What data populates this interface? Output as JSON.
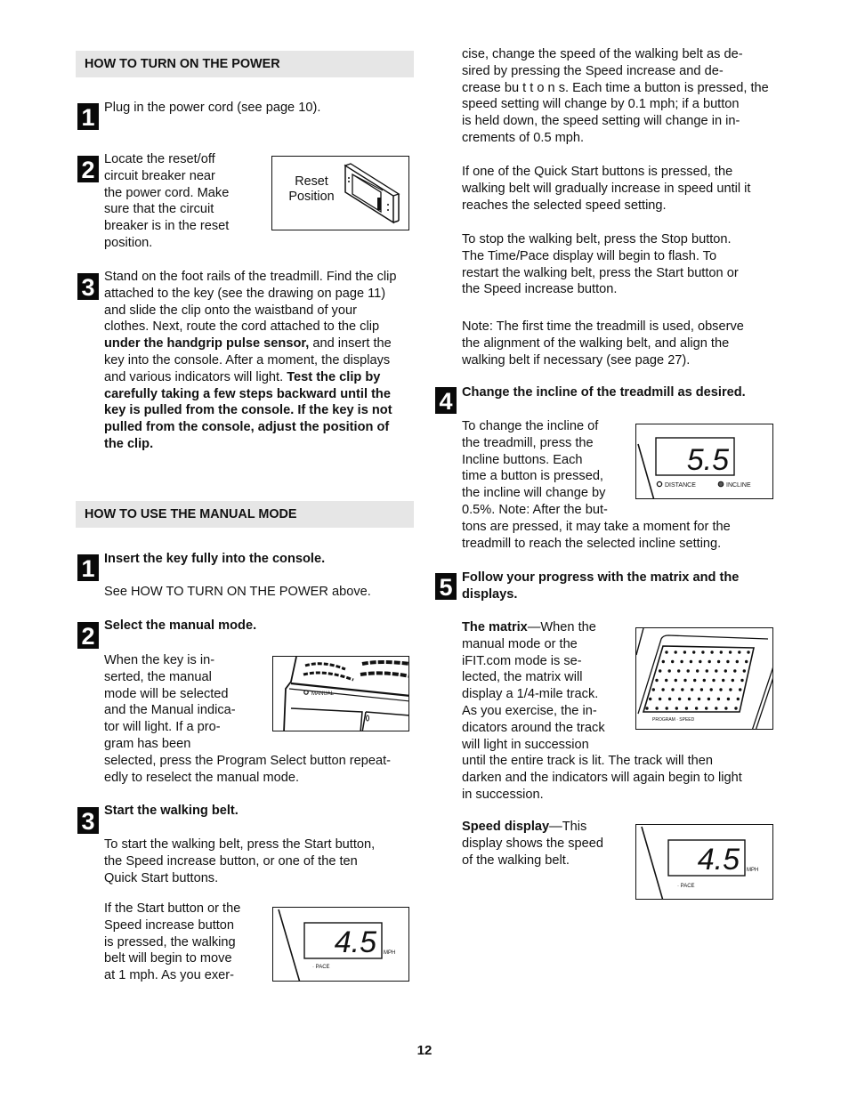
{
  "left_column": {
    "power_section": {
      "heading": "HOW TO TURN ON THE POWER",
      "steps": [
        {
          "number": "1",
          "text": "Plug in the power cord (see page 10)."
        },
        {
          "number": "2",
          "lines": [
            "Locate the reset/off",
            "circuit breaker near",
            "the power cord. Make",
            "sure that the circuit",
            "breaker is in the reset",
            "position."
          ],
          "figure": {
            "label_line1": "Reset",
            "label_line2": "Position",
            "icon": "circuit-breaker-illustration"
          }
        },
        {
          "number": "3",
          "lines": [
            {
              "normal": "Stand on the foot rails of the treadmill. Find the clip"
            },
            {
              "normal": "attached to the key (see the drawing on page 11)"
            },
            {
              "normal": "and slide the clip onto the waistband of your"
            },
            {
              "normal": "clothes. Next, route the cord attached to the clip"
            },
            {
              "bold": "under the handgrip pulse sensor,",
              "normal": " and insert the"
            },
            {
              "normal": "key into the console. After a moment, the displays"
            },
            {
              "normal": "and various indicators will light. ",
              "bold": "Test the clip by"
            },
            {
              "bold": "carefully taking a few steps backward until the"
            },
            {
              "bold": "key is pulled from the console. If the key is not"
            },
            {
              "bold": "pulled from the console, adjust the position of"
            },
            {
              "bold": "the clip."
            }
          ]
        }
      ]
    },
    "manual_section": {
      "heading": "HOW TO USE THE MANUAL MODE",
      "steps": [
        {
          "number": "1",
          "title": "Insert the key fully into the console.",
          "body": "See HOW TO TURN ON THE POWER above."
        },
        {
          "number": "2",
          "title": "Select the manual mode.",
          "lines": [
            "When the key is in-",
            "serted, the manual",
            "mode will be selected",
            "and the Manual indica-",
            "tor will light. If a pro-",
            "gram has been"
          ],
          "lines_full": [
            "selected, press the Program Select button repeat-",
            "edly to reselect the manual mode."
          ],
          "figure": {
            "icon": "console-manual-indicator-illustration"
          }
        },
        {
          "number": "3",
          "title": "Start the walking belt.",
          "body_lines": [
            "To start the walking belt, press the Start button,",
            "the Speed increase button, or one of the ten",
            "Quick Start buttons."
          ],
          "lines": [
            "If the Start button or the",
            "Speed increase button",
            "is pressed, the walking",
            "belt will begin to move",
            "at 1 mph. As you exer-"
          ],
          "figure": {
            "display_value": "4.5",
            "icon": "speed-display-illustration"
          }
        }
      ]
    }
  },
  "right_column": {
    "continued_lines": [
      "cise, change the speed of the walking belt as de-",
      "sired by pressing the Speed increase and de-",
      "crease bu t t o n s. Each time a button is pressed, the",
      "speed setting will change by 0.1 mph; if a button",
      "is held down, the speed setting will change in in-",
      "crements of 0.5 mph."
    ],
    "quick_start_lines": [
      "If one of the Quick Start buttons is pressed, the",
      "walking belt will gradually increase in speed until it",
      "reaches the selected speed setting."
    ],
    "stop_lines": [
      "To stop the walking belt, press the Stop button.",
      "The Time/Pace display will begin to flash. To",
      "restart the walking belt, press the Start button or",
      "the Speed increase button."
    ],
    "note_lines": [
      "Note: The first time the treadmill is used, observe",
      "the alignment of the walking belt, and align the",
      "walking belt if necessary (see page 27)."
    ],
    "step4": {
      "number": "4",
      "title": "Change the incline of the treadmill as desired.",
      "lines": [
        "To change the incline of",
        "the treadmill, press the",
        "Incline buttons. Each",
        "time a button is pressed,",
        "the incline will change by",
        "0.5%. Note: After the but-"
      ],
      "lines_full": [
        "tons are pressed, it may take a moment for the",
        "treadmill to reach the selected incline setting."
      ],
      "figure": {
        "display_value": "5.5",
        "indicator_left": "DISTANCE",
        "indicator_right": "INCLINE",
        "icon": "incline-display-illustration"
      }
    },
    "step5": {
      "number": "5",
      "title_lines": [
        "Follow your progress with the matrix and the",
        "displays."
      ],
      "matrix": {
        "term": "The matrix",
        "dash": "—When the",
        "lines": [
          "manual mode or the",
          "iFIT.com mode is se-",
          "lected, the matrix will",
          "display a 1/4-mile track.",
          "As you exercise, the in-",
          "dicators around the track",
          "will light in succession"
        ],
        "lines_full": [
          "until the entire track is lit. The track will then",
          "darken and the indicators will again begin to light",
          "in succession."
        ],
        "figure": {
          "icon": "matrix-display-illustration"
        }
      },
      "speed": {
        "term": "Speed display",
        "dash": "—This",
        "lines": [
          "display shows the speed",
          "of the walking belt."
        ],
        "figure": {
          "display_value": "4.5",
          "icon": "speed-display-illustration"
        }
      }
    }
  },
  "page_number": "12"
}
